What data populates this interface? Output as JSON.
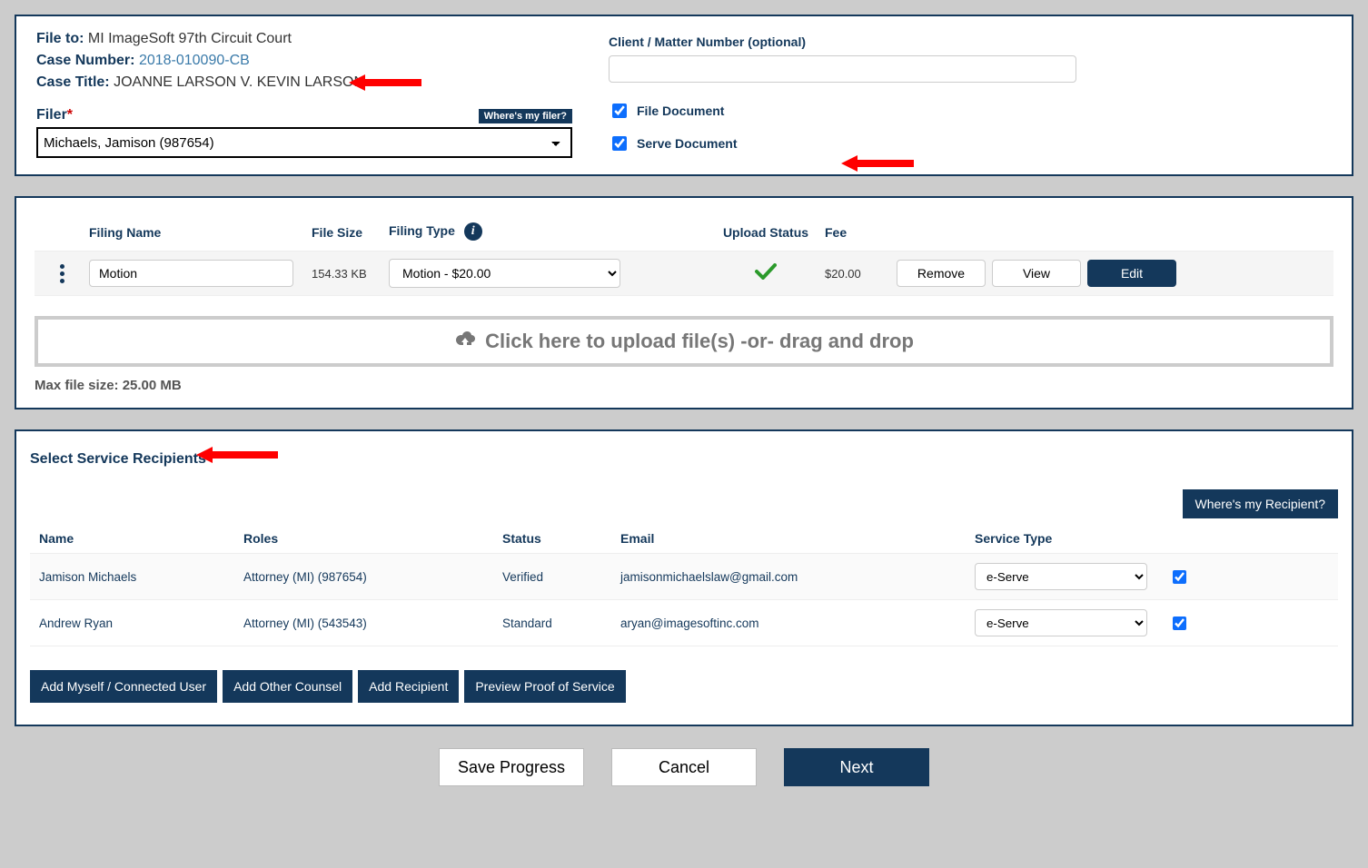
{
  "header": {
    "file_to_label": "File to:",
    "file_to_value": "MI ImageSoft 97th Circuit Court",
    "case_number_label": "Case Number:",
    "case_number_value": "2018-010090-CB",
    "case_title_label": "Case Title:",
    "case_title_value": "JOANNE LARSON V. KEVIN LARSON",
    "filer_label": "Filer",
    "filer_help_badge": "Where's my filer?",
    "filer_selected": "Michaels, Jamison (987654)",
    "client_matter_label": "Client / Matter Number (optional)",
    "client_matter_value": "",
    "file_document_label": "File Document",
    "file_document_checked": true,
    "serve_document_label": "Serve Document",
    "serve_document_checked": true
  },
  "files": {
    "headers": {
      "filing_name": "Filing Name",
      "file_size": "File Size",
      "filing_type": "Filing Type",
      "upload_status": "Upload Status",
      "fee": "Fee"
    },
    "rows": [
      {
        "name": "Motion",
        "size": "154.33 KB",
        "type": "Motion - $20.00",
        "status_ok": true,
        "fee": "$20.00"
      }
    ],
    "buttons": {
      "remove": "Remove",
      "view": "View",
      "edit": "Edit"
    },
    "upload_text": "Click here to upload file(s) -or- drag and drop",
    "max_file": "Max file size: 25.00 MB"
  },
  "recipients": {
    "title": "Select Service Recipients",
    "help_badge": "Where's my Recipient?",
    "headers": {
      "name": "Name",
      "roles": "Roles",
      "status": "Status",
      "email": "Email",
      "service_type": "Service Type"
    },
    "rows": [
      {
        "name": "Jamison Michaels",
        "roles": "Attorney (MI) (987654)",
        "status": "Verified",
        "email": "jamisonmichaelslaw@gmail.com",
        "service_type": "e-Serve",
        "checked": true
      },
      {
        "name": "Andrew Ryan",
        "roles": "Attorney (MI) (543543)",
        "status": "Standard",
        "email": "aryan@imagesoftinc.com",
        "service_type": "e-Serve",
        "checked": true
      }
    ],
    "buttons": {
      "add_myself": "Add Myself / Connected User",
      "add_counsel": "Add Other Counsel",
      "add_recipient": "Add Recipient",
      "preview": "Preview Proof of Service"
    }
  },
  "nav": {
    "save": "Save Progress",
    "cancel": "Cancel",
    "next": "Next"
  }
}
